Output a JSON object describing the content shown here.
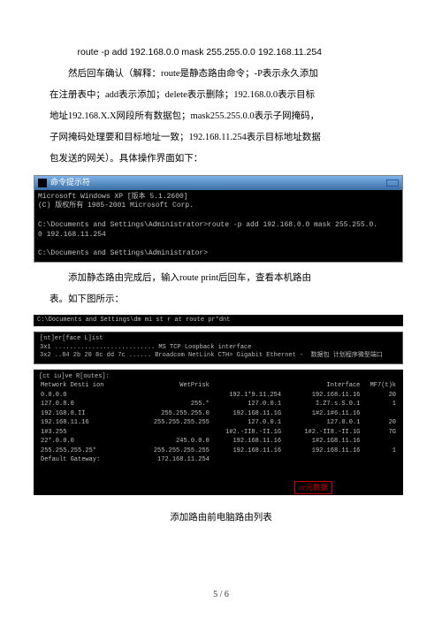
{
  "page": {
    "lines": [
      "route -p add 192.168.0.0 mask 255.255.0.0 192.168.11.254",
      "然后回车确认（解释：route是静态路由命令；-P表示永久添加",
      "在注册表中；add表示添加；delete表示删除；192.168.0.0表示目标",
      "地址192.168.X.X网段所有数据包；mask255.255.0.0表示子网掩码，",
      "子网掩码处理要和目标地址一致；192.168.11.254表示目标地址数据",
      "包发送的网关）。具体操作界面如下："
    ],
    "after1": "添加静态路由完成后，输入route print后回车，查看本机路由",
    "after1b": "表。如下图所示：",
    "after2": "添加路由前电脑路由列表"
  },
  "term1": {
    "title": "命令提示符",
    "body": "Microsoft Windows XP [版本 5.1.2600]\n(C) 版权所有 1985-2001 Microsoft Corp.\n\nC:\\Documents and Settings\\Administrator>route -p add 192.168.0.0 mask 255.255.0.\n0 192.168.11.254\n\nC:\\Documents and Settings\\Administrator>"
  },
  "term2": {
    "header": "C:\\Documents and Settings\\dm mi st r at route pr*dnt",
    "iface_title": "[nt]er[face L]ist",
    "iface_rows": [
      "3x1 ........................... MS TCP Loopback interface",
      "3x2 ..84 2b 20 8c dd 7c ...... Broadcom NetLink CTH> Gigabit Ethernet -  数据包 计划程序微型端口"
    ],
    "routes_title": "[ct iu]ve R[outes]:",
    "cols": [
      "Metwork Desti    ion",
      "WetPrisk",
      "",
      "Interface",
      "MF7(t)k"
    ],
    "rows": [
      [
        "0.0.0.0",
        "",
        "192.1*9.11.254",
        "192.168.11.16",
        "20"
      ],
      [
        "127.0.8.0",
        "255.*",
        "127.0.0.1",
        "I.Z7.s.S.0.1",
        "1"
      ],
      [
        "192.1G8.8.II",
        "255.255.255.0",
        "192.1G8.11.1G",
        "1#2.1#6.11.16",
        ""
      ],
      [
        "192.168.11.16",
        "255.255.255.255",
        "127.0.0.1",
        "127.0.0.1",
        "20"
      ],
      [
        "1#3.255",
        "",
        "1#2.-II8.-II.1G",
        "1#2.-II8.-II.1G",
        "7G"
      ],
      [
        "22*.0.0.0",
        "245.0.0.0",
        "192.168.11.16",
        "1#2.1G8.11.16",
        ""
      ],
      [
        "255.255.255.25*",
        "255.255.255.255",
        "192.168.11.16",
        "192.168.11.16",
        "1"
      ]
    ],
    "gateway_label": "Default Gateway:",
    "gateway_val": "172.168.11.254",
    "redbox": "cc元数据"
  },
  "pagenum": "5 / 6"
}
